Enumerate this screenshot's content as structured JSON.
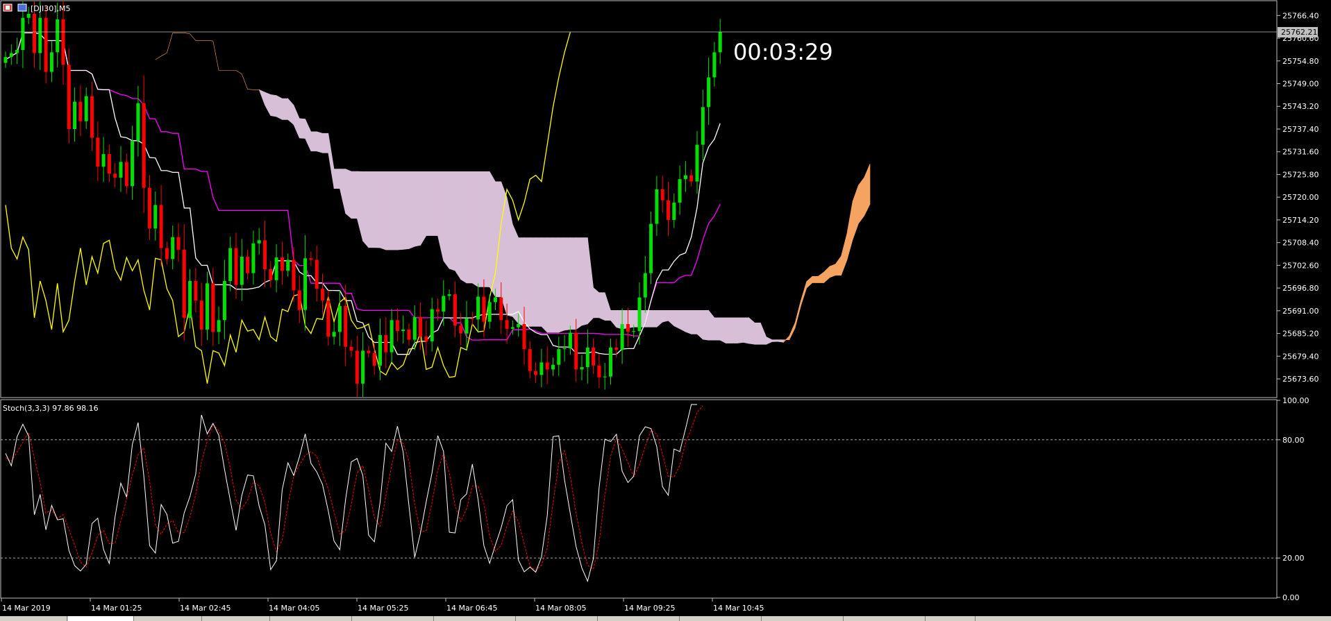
{
  "window": {
    "symbol_title": "[DJI30],M5",
    "countdown": "00:03:29",
    "current_price_label": "25762.21"
  },
  "colors": {
    "background": "#000000",
    "bull_candle": "#00e000",
    "bear_candle": "#ff0000",
    "tenkan": "#ffffff",
    "kijun": "#ff00ff",
    "chikou": "#ffff00",
    "kumo_bull": "#f4a460",
    "kumo_bear": "#d8bfd8",
    "stoch_main": "#ffffff",
    "stoch_signal": "#ff0000"
  },
  "chart_data": [
    {
      "type": "candlestick",
      "instrument": "[DJI30],M5",
      "indicators": [
        "Ichimoku Kinko Hyo",
        "Current bar timer"
      ],
      "y_ticks": [
        25766.4,
        25760.6,
        25754.8,
        25749.0,
        25743.2,
        25737.4,
        25731.6,
        25725.8,
        25720.0,
        25714.2,
        25708.4,
        25702.6,
        25696.8,
        25691.0,
        25685.2,
        25679.4,
        25673.6
      ],
      "y_tick_labels": [
        "25766.40",
        "25760.60",
        "25754.80",
        "25749.00",
        "25743.20",
        "25737.40",
        "25731.60",
        "25725.80",
        "25720.00",
        "25714.20",
        "25708.40",
        "25702.60",
        "25696.80",
        "25691.00",
        "25685.20",
        "25679.40",
        "25673.60"
      ],
      "ylim": [
        25669.0,
        25770.0
      ],
      "current_price": 25762.21,
      "x_tick_labels": [
        "14 Mar 2019",
        "14 Mar 01:25",
        "14 Mar 02:45",
        "14 Mar 04:05",
        "14 Mar 05:25",
        "14 Mar 06:45",
        "14 Mar 08:05",
        "14 Mar 09:25",
        "14 Mar 10:45"
      ],
      "close": [
        25755.8,
        25756.8,
        25757.6,
        25765.8,
        25766.8,
        25756.8,
        25765.8,
        25752.0,
        25757.0,
        25765.4,
        25753.8,
        25737.4,
        25744.4,
        25739.4,
        25745.8,
        25735.2,
        25727.8,
        25731.0,
        25726.0,
        25725.0,
        25729.0,
        25722.8,
        25734.4,
        25744.0,
        25722.4,
        25712.0,
        25718.0,
        25707.0,
        25704.2,
        25709.8,
        25706.6,
        25689.2,
        25698.6,
        25693.6,
        25686.2,
        25698.0,
        25685.6,
        25688.6,
        25698.6,
        25707.0,
        25697.6,
        25704.8,
        25700.6,
        25708.2,
        25709.0,
        25701.6,
        25698.8,
        25704.6,
        25701.2,
        25704.0,
        25696.2,
        25691.2,
        25704.4,
        25704.0,
        25696.6,
        25693.6,
        25684.4,
        25685.6,
        25692.2,
        25681.8,
        25680.8,
        25672.4,
        25680.8,
        25680.2,
        25677.0,
        25684.8,
        25680.4,
        25688.6,
        25685.8,
        25686.2,
        25683.6,
        25689.4,
        25684.4,
        25683.2,
        25691.4,
        25690.8,
        25694.8,
        25695.2,
        25687.2,
        25685.2,
        25689.0,
        25688.8,
        25694.6,
        25688.2,
        25693.2,
        25694.4,
        25688.6,
        25686.4,
        25686.8,
        25687.6,
        25681.2,
        25675.6,
        25674.6,
        25677.8,
        25676.0,
        25677.2,
        25681.2,
        25681.4,
        25685.4,
        25676.0,
        25676.6,
        25681.6,
        25677.0,
        25674.0,
        25674.2,
        25681.6,
        25681.0,
        25687.6,
        25685.6,
        25685.8,
        25694.4,
        25700.6,
        25713.2,
        25722.0,
        25719.2,
        25714.2,
        25718.6,
        25724.6,
        25725.6,
        25724.0,
        25733.4,
        25743.0,
        25750.6,
        25757.0,
        25762.2
      ],
      "ichimoku_visible": [
        "Tenkan-sen (white)",
        "Kijun-sen (magenta)",
        "Chikou Span (yellow)",
        "Senkou Span A/B cloud"
      ],
      "title": "",
      "xlabel": "",
      "ylabel": ""
    },
    {
      "type": "line",
      "title": "Stoch(3,3,3) 97.86 98.16",
      "series": [
        {
          "name": "",
          "values": [
            73.1,
            66.8,
            81.6,
            87.9,
            81.9,
            41.9,
            52.3,
            34.3,
            46.7,
            39.4,
            39.9,
            23.8,
            16.1,
            13.4,
            16.8,
            37.5,
            40.2,
            24.4,
            17.2,
            40.8,
            58.0,
            50.9,
            77.6,
            88.7,
            61.5,
            26.3,
            22.5,
            47.1,
            42.1,
            27.5,
            28.5,
            42.9,
            51.2,
            62.6,
            92.6,
            83.0,
            88.3,
            82.3,
            64.9,
            49.2,
            34.0,
            51.8,
            62.1,
            61.7,
            46.4,
            36.9,
            14.1,
            18.6,
            54.5,
            68.3,
            61.9,
            71.4,
            83.0,
            68.0,
            63.7,
            57.3,
            43.9,
            28.6,
            24.2,
            49.6,
            68.8,
            70.5,
            61.8,
            31.6,
            28.2,
            48.4,
            78.3,
            74.1,
            86.9,
            73.7,
            46.6,
            20.3,
            32.7,
            48.6,
            63.2,
            82.1,
            74.1,
            33.1,
            32.7,
            49.6,
            52.5,
            67.6,
            49.6,
            26.3,
            17.3,
            26.6,
            35.4,
            46.6,
            49.6,
            18.9,
            13.0,
            15.4,
            12.8,
            20.6,
            41.5,
            81.6,
            82.0,
            59.6,
            42.5,
            25.8,
            15.0,
            8.2,
            19.6,
            55.8,
            80.3,
            79.1,
            82.8,
            64.0,
            58.3,
            61.5,
            82.0,
            86.6,
            85.7,
            76.5,
            56.2,
            51.8,
            75.3,
            74.0,
            85.6,
            97.9,
            97.9
          ]
        },
        {
          "name": "",
          "values": [
            70.9,
            69.0,
            73.8,
            78.8,
            83.8,
            70.6,
            58.7,
            42.8,
            44.4,
            40.1,
            42.0,
            34.4,
            26.6,
            17.8,
            15.4,
            22.6,
            31.5,
            34.0,
            27.3,
            27.5,
            38.7,
            49.9,
            62.2,
            72.4,
            76.0,
            58.8,
            36.8,
            32.0,
            37.2,
            39.0,
            32.7,
            32.9,
            40.8,
            52.2,
            68.8,
            79.4,
            88.0,
            84.5,
            78.5,
            65.5,
            49.4,
            45.0,
            49.3,
            58.5,
            56.7,
            48.3,
            32.5,
            23.2,
            29.1,
            47.1,
            61.6,
            67.2,
            72.1,
            74.1,
            71.6,
            63.0,
            55.0,
            43.3,
            32.2,
            34.1,
            47.5,
            63.0,
            67.0,
            54.6,
            40.5,
            36.1,
            51.6,
            66.9,
            79.8,
            78.2,
            69.1,
            46.9,
            33.2,
            33.9,
            48.2,
            64.6,
            73.1,
            63.1,
            46.6,
            38.5,
            44.9,
            56.6,
            56.6,
            47.8,
            31.1,
            23.4,
            26.4,
            36.2,
            43.9,
            38.4,
            27.2,
            15.8,
            13.7,
            16.3,
            25.0,
            47.9,
            68.4,
            74.4,
            61.4,
            42.6,
            27.8,
            16.3,
            14.3,
            27.9,
            51.9,
            71.7,
            80.7,
            75.3,
            68.4,
            61.3,
            67.3,
            76.7,
            84.8,
            82.9,
            72.8,
            61.5,
            61.1,
            67.0,
            78.3,
            85.8,
            93.8,
            97.3
          ]
        }
      ],
      "y_tick_labels": [
        "100.00",
        "80.00",
        "20.00",
        "0.00"
      ],
      "y_ticks": [
        100,
        80,
        20,
        0
      ],
      "levels": [
        80,
        20
      ],
      "ylim": [
        0,
        100
      ]
    }
  ]
}
